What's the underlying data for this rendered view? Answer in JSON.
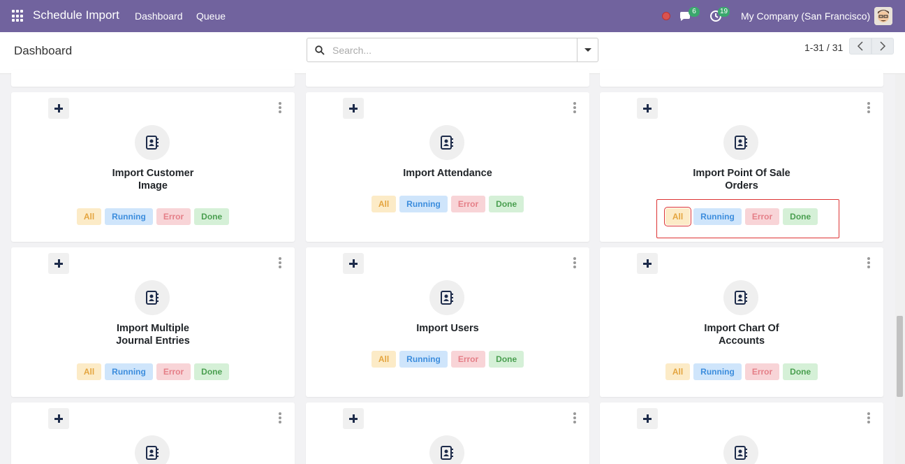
{
  "navbar": {
    "app_title": "Schedule Import",
    "links": [
      "Dashboard",
      "Queue"
    ],
    "messages_count": "6",
    "activities_count": "19",
    "company": "My Company (San Francisco)"
  },
  "control": {
    "breadcrumb": "Dashboard",
    "search_placeholder": "Search...",
    "pager": "1-31 / 31"
  },
  "chips": {
    "all": "All",
    "running": "Running",
    "error": "Error",
    "done": "Done"
  },
  "cards": [
    {
      "title_line1": "Import Customer",
      "title_line2": "Image"
    },
    {
      "title_line1": "Import Attendance",
      "title_line2": ""
    },
    {
      "title_line1": "Import Point Of Sale",
      "title_line2": "Orders"
    },
    {
      "title_line1": "Import Multiple",
      "title_line2": "Journal Entries"
    },
    {
      "title_line1": "Import Users",
      "title_line2": ""
    },
    {
      "title_line1": "Import Chart Of",
      "title_line2": "Accounts"
    }
  ],
  "colors": {
    "navbar": "#71639e",
    "highlight": "#dd3333"
  }
}
